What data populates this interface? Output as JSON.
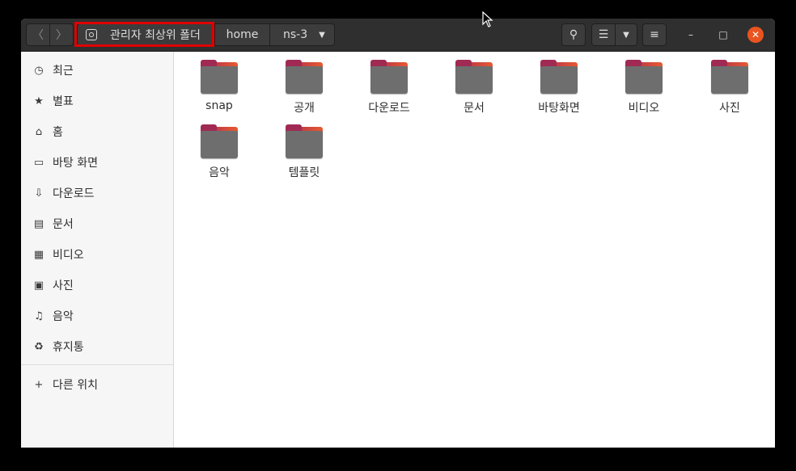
{
  "header": {
    "back_icon": "〈",
    "forward_icon": "〉",
    "root_label": "관리자 최상위 폴더",
    "crumbs": [
      "home",
      "ns-3"
    ],
    "dropdown_icon": "▼",
    "search_icon": "⚲",
    "view_icon": "☰",
    "menu_icon": "≡",
    "minimize_icon": "–",
    "maximize_icon": "□",
    "close_icon": "✕"
  },
  "sidebar": {
    "items": [
      {
        "icon": "◷",
        "label": "최근"
      },
      {
        "icon": "★",
        "label": "별표"
      },
      {
        "icon": "⌂",
        "label": "홈"
      },
      {
        "icon": "▭",
        "label": "바탕 화면"
      },
      {
        "icon": "⇩",
        "label": "다운로드"
      },
      {
        "icon": "▤",
        "label": "문서"
      },
      {
        "icon": "▦",
        "label": "비디오"
      },
      {
        "icon": "▣",
        "label": "사진"
      },
      {
        "icon": "♫",
        "label": "음악"
      },
      {
        "icon": "♻",
        "label": "휴지통"
      }
    ],
    "other_locations": {
      "icon": "+",
      "label": "다른 위치"
    }
  },
  "files": [
    {
      "name": "snap"
    },
    {
      "name": "공개"
    },
    {
      "name": "다운로드"
    },
    {
      "name": "문서"
    },
    {
      "name": "바탕화면"
    },
    {
      "name": "비디오"
    },
    {
      "name": "사진"
    },
    {
      "name": "음악"
    },
    {
      "name": "템플릿"
    }
  ],
  "colors": {
    "accent": "#e95420",
    "highlight_border": "#e00000",
    "folder_body": "#6e6e6e"
  }
}
